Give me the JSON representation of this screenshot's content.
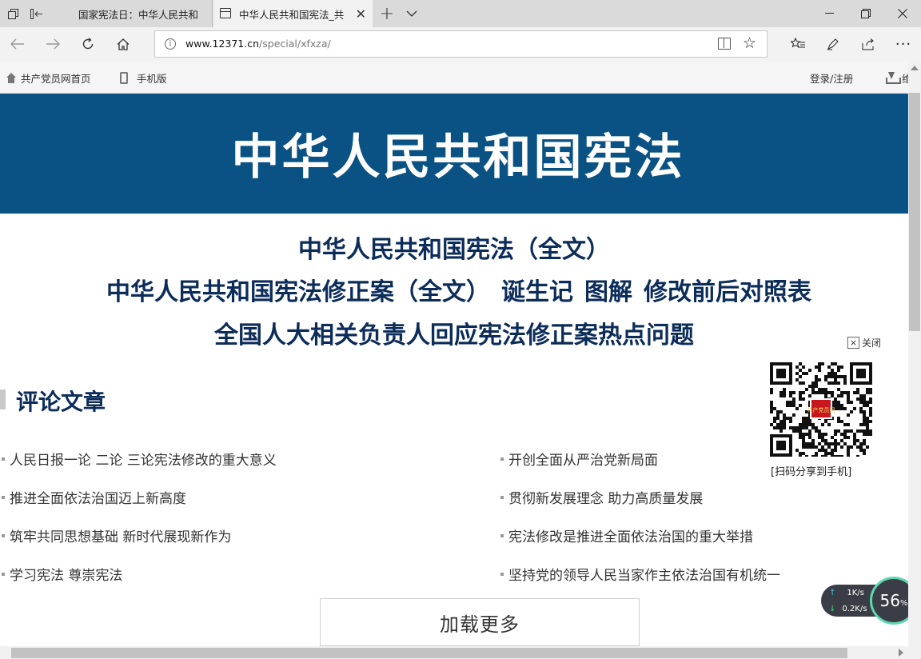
{
  "browser": {
    "tabs": [
      {
        "title": "国家宪法日：中华人民共和",
        "active": false
      },
      {
        "title": "中华人民共和国宪法_共",
        "active": true
      }
    ],
    "url_host": "www.12371.cn",
    "url_path": "/special/xfxza/"
  },
  "site_nav": {
    "home": "共产党员网首页",
    "mobile": "手机版",
    "login": "登录/注册",
    "download_partial": "维"
  },
  "banner": {
    "title": "中华人民共和国宪法"
  },
  "headlines": {
    "line1": "中华人民共和国宪法（全文）",
    "line2_a": "中华人民共和国宪法修正案（全文）",
    "line2_b": "诞生记",
    "line2_c": "图解",
    "line2_d": "修改前后对照表",
    "line3": "全国人大相关负责人回应宪法修正案热点问题"
  },
  "qr_panel": {
    "close": "关闭",
    "caption": "[扫码分享到手机]",
    "logo_text": "共产党员网"
  },
  "section": {
    "title": "评论文章"
  },
  "articles": {
    "left": [
      "人民日报一论 二论 三论宪法修改的重大意义",
      "推进全面依法治国迈上新高度",
      "筑牢共同思想基础 新时代展现新作为",
      "学习宪法 尊崇宪法"
    ],
    "right": [
      "开创全面从严治党新局面",
      "贯彻新发展理念 助力高质量发展",
      "宪法修改是推进全面依法治国的重大举措",
      "坚持党的领导人民当家作主依法治国有机统一"
    ]
  },
  "load_more": "加载更多",
  "speed_widget": {
    "up": "1K/s",
    "down": "0.2K/s",
    "percent": "56",
    "percent_unit": "%"
  },
  "colors": {
    "banner": "#0a5283",
    "headline": "#0c2c5a"
  }
}
